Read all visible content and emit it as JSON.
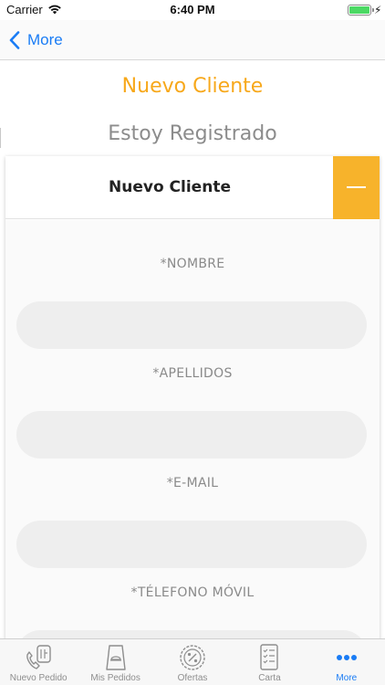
{
  "status_bar": {
    "carrier": "Carrier",
    "time": "6:40 PM"
  },
  "nav": {
    "back_label": "More"
  },
  "tabs": {
    "nuevo_cliente": "Nuevo Cliente",
    "estoy_registrado": "Estoy Registrado",
    "active": "nuevo_cliente"
  },
  "card": {
    "title": "Nuevo Cliente",
    "fields": [
      {
        "label": "*NOMBRE",
        "value": ""
      },
      {
        "label": "*APELLIDOS",
        "value": ""
      },
      {
        "label": "*E-MAIL",
        "value": ""
      },
      {
        "label": "*TÉLEFONO MÓVIL",
        "value": ""
      }
    ]
  },
  "tab_bar": {
    "items": [
      {
        "label": "Nuevo Pedido",
        "icon": "phone-order-icon"
      },
      {
        "label": "Mis Pedidos",
        "icon": "bag-icon"
      },
      {
        "label": "Ofertas",
        "icon": "percent-badge-icon"
      },
      {
        "label": "Carta",
        "icon": "menu-list-icon"
      },
      {
        "label": "More",
        "icon": "more-dots-icon"
      }
    ],
    "active_index": 4
  },
  "colors": {
    "accent_orange": "#f7a81b",
    "ios_blue": "#1a7cf5",
    "battery_green": "#4cd964"
  }
}
